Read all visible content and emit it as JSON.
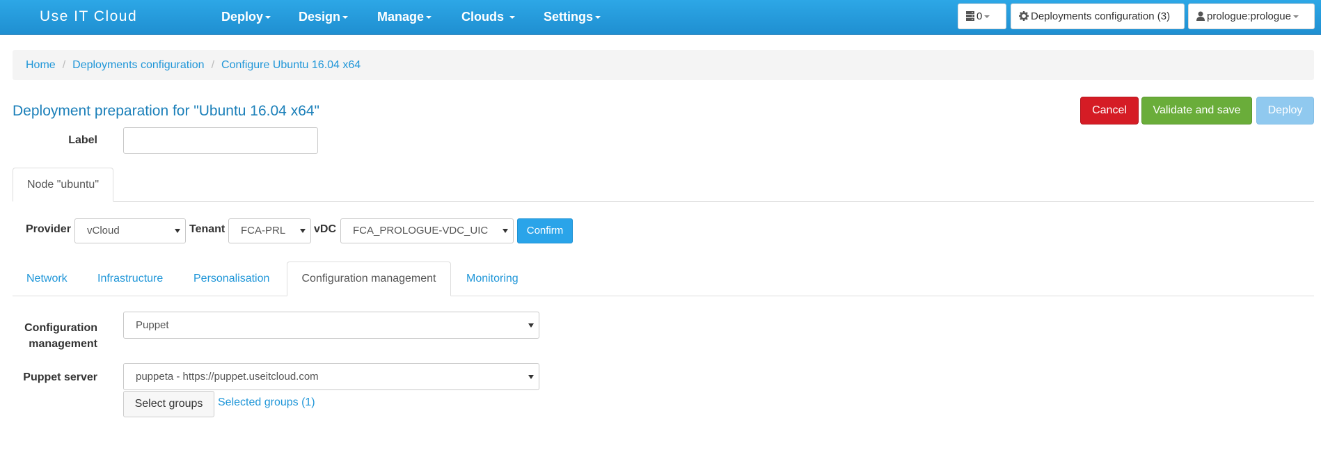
{
  "navbar": {
    "brand": "Use IT Cloud",
    "menus": [
      {
        "label": "Deploy"
      },
      {
        "label": "Design"
      },
      {
        "label": "Manage"
      },
      {
        "label": "Clouds"
      },
      {
        "label": "Settings"
      }
    ],
    "server_count": "0",
    "deployments_config": "Deployments configuration (3)",
    "user": "prologue:prologue",
    "icons": {
      "server": "server-icon",
      "gear": "gear-icon",
      "user": "user-icon"
    }
  },
  "breadcrumb": [
    "Home",
    "Deployments configuration",
    "Configure Ubuntu 16.04 x64"
  ],
  "page": {
    "title": "Deployment preparation for \"Ubuntu 16.04 x64\"",
    "actions": {
      "cancel": "Cancel",
      "validate": "Validate and save",
      "deploy": "Deploy"
    },
    "label_field": {
      "label": "Label",
      "value": ""
    }
  },
  "node_tab": "Node \"ubuntu\"",
  "provider_row": {
    "provider_label": "Provider",
    "provider_value": "vCloud",
    "tenant_label": "Tenant",
    "tenant_value": "FCA-PRL",
    "vdc_label": "vDC",
    "vdc_value": "FCA_PROLOGUE-VDC_UIC",
    "confirm": "Confirm"
  },
  "tabs": [
    {
      "label": "Network",
      "active": false
    },
    {
      "label": "Infrastructure",
      "active": false
    },
    {
      "label": "Personalisation",
      "active": false
    },
    {
      "label": "Configuration management",
      "active": true
    },
    {
      "label": "Monitoring",
      "active": false
    }
  ],
  "config": {
    "cm_label_line1": "Configuration",
    "cm_label_line2": "management",
    "cm_value": "Puppet",
    "puppet_label": "Puppet server",
    "puppet_value": "puppeta - https://puppet.useitcloud.com",
    "select_groups": "Select groups",
    "selected_groups": "Selected groups (1)"
  },
  "colors": {
    "navbar": "#1f96d8",
    "cancel": "#d51c25",
    "validate": "#6aad3a",
    "deploy": "#90c9ef",
    "confirm": "#2aa4e9",
    "link": "#1f96d8",
    "title": "#1a7fb9"
  }
}
